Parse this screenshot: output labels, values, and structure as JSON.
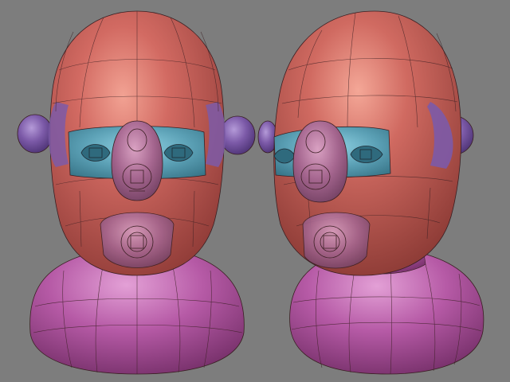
{
  "scene": {
    "background": "#7d7d7d",
    "colors": {
      "head": "#c9625c",
      "head_highlight": "#ee9a8c",
      "head_shadow": "#8f3b37",
      "body": "#b65aa6",
      "body_highlight": "#dc92cf",
      "body_shadow": "#7a2f6d",
      "ear": "#7c5aa8",
      "eye_band": "#5a9fb4",
      "nose_mouth": "#a5668f",
      "wire": "#3a1f22"
    },
    "models": [
      {
        "id": "front",
        "view": "front"
      },
      {
        "id": "three-quarter",
        "view": "three-quarter"
      }
    ]
  }
}
